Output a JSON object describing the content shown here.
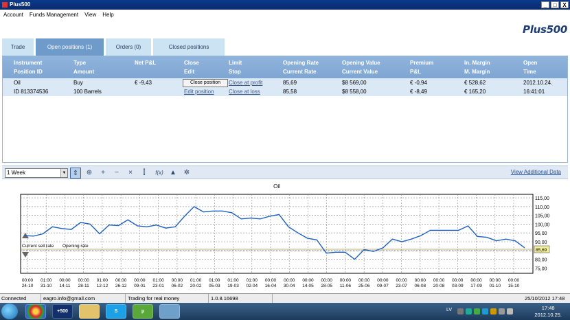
{
  "window": {
    "title": "Plus500",
    "minimize": "_",
    "maximize": "□",
    "close": "X"
  },
  "menu": [
    "Account",
    "Funds Management",
    "View",
    "Help"
  ],
  "brand": "Plus500",
  "tabs": [
    {
      "label": "Trade",
      "active": false
    },
    {
      "label": "Open positions (1)",
      "active": true
    },
    {
      "label": "Orders (0)",
      "active": false
    },
    {
      "label": "Closed positions",
      "active": false
    }
  ],
  "positions": {
    "columns_top": [
      "Instrument",
      "Type",
      "Net P&L",
      "Close",
      "Limit",
      "Opening Rate",
      "Opening Value",
      "Premium",
      "In. Margin",
      "Open"
    ],
    "columns_bottom": [
      "Position ID",
      "Amount",
      "",
      "Edit",
      "Stop",
      "Current Rate",
      "Current Value",
      "P&L",
      "M. Margin",
      "Time"
    ],
    "row_top": [
      "Oil",
      "Buy",
      "€ -9,43",
      "Close position",
      "Close at profit",
      "85,69",
      "$8 569,00",
      "€ -0,94",
      "€ 528,62",
      "2012.10.24."
    ],
    "row_bottom": [
      "ID 813374536",
      "100 Barrels",
      "",
      "Edit position",
      "Close at loss",
      "85,58",
      "$8 558,00",
      "€ -8,49",
      "€ 165,20",
      "16:41:01"
    ]
  },
  "chart_toolbar": {
    "period": "1 Week",
    "period_arrow": "▼",
    "tools": [
      "cursor-icon",
      "crosshair-icon",
      "zoom-in-icon",
      "zoom-out-icon",
      "zoom-reset-icon",
      "candlestick-icon",
      "function-icon",
      "alert-bell-icon",
      "settings-gear-icon"
    ],
    "tool_glyphs": [
      "⇕",
      "⊕",
      "+",
      "−",
      "×",
      "⫿",
      "f(x)",
      "▲",
      "✲"
    ],
    "view_additional": "View Additional Data"
  },
  "chart_data": {
    "type": "line",
    "title": "Oil",
    "ylim": [
      72,
      117
    ],
    "y_ticks": [
      75,
      80,
      85,
      90,
      95,
      100,
      105,
      110,
      115
    ],
    "y_tick_labels": [
      "75,00",
      "80,00",
      "85,00",
      "90,00",
      "95,00",
      "100,00",
      "105,00",
      "110,00",
      "115,00"
    ],
    "x_tick_times": [
      "00:00",
      "01:00",
      "00:00",
      "00:00",
      "01:00",
      "00:00",
      "00:00",
      "01:00",
      "00:00",
      "01:00",
      "01:00",
      "01:00",
      "01:00",
      "00:00",
      "00:00",
      "00:00",
      "00:00",
      "00:00",
      "00:00",
      "00:00",
      "00:00",
      "00:00",
      "00:00",
      "00:00",
      "00:00",
      "00:00",
      "00:00"
    ],
    "x_tick_dates": [
      "24-10",
      "31-10",
      "14-11",
      "28-11",
      "12-12",
      "26-12",
      "09-01",
      "23-01",
      "06-02",
      "20-02",
      "05-03",
      "19-03",
      "02-04",
      "16-04",
      "30-04",
      "14-05",
      "28-05",
      "11-06",
      "25-06",
      "09-07",
      "23-07",
      "06-08",
      "20-08",
      "03-09",
      "17-09",
      "01-10",
      "15-10"
    ],
    "series": [
      {
        "color": "#1f5fbf",
        "values": [
          93.5,
          93.2,
          94.5,
          98.5,
          97.5,
          97.0,
          101.0,
          100.0,
          94.5,
          99.5,
          99.2,
          102.5,
          99.0,
          98.5,
          99.5,
          97.8,
          98.5,
          104.5,
          110.0,
          107.0,
          107.5,
          107.5,
          106.5,
          103.0,
          103.5,
          103.0,
          104.5,
          105.5,
          98.5,
          95.0,
          92.0,
          91.0,
          83.5,
          84.0,
          84.0,
          80.0,
          85.5,
          84.5,
          86.5,
          91.5,
          90.0,
          91.5,
          93.5,
          96.5,
          96.5,
          96.5,
          96.5,
          99.0,
          93.0,
          92.5,
          90.5,
          91.5,
          90.5,
          86.5
        ]
      }
    ],
    "current_rate": 85.69,
    "current_rate_label": "85,69",
    "opening_rate": 85.58,
    "annotations": [
      "Current sell rate",
      "Opening rate"
    ],
    "grid": true
  },
  "status": {
    "connection": "Connected",
    "email": "eagro.info@gmail.com",
    "mode": "Trading for real money",
    "version": "1.0.8.16698",
    "datetime": "25/10/2012 17:48"
  },
  "taskbar": {
    "apps": [
      "chrome-icon",
      "plus500-icon",
      "folder-icon",
      "skype-icon",
      "utorrent-icon",
      "network-icon"
    ],
    "app_labels": [
      "",
      "+500",
      "",
      "S",
      "µ",
      ""
    ],
    "lang": "LV",
    "time": "17:48",
    "date": "2012.10.25."
  }
}
